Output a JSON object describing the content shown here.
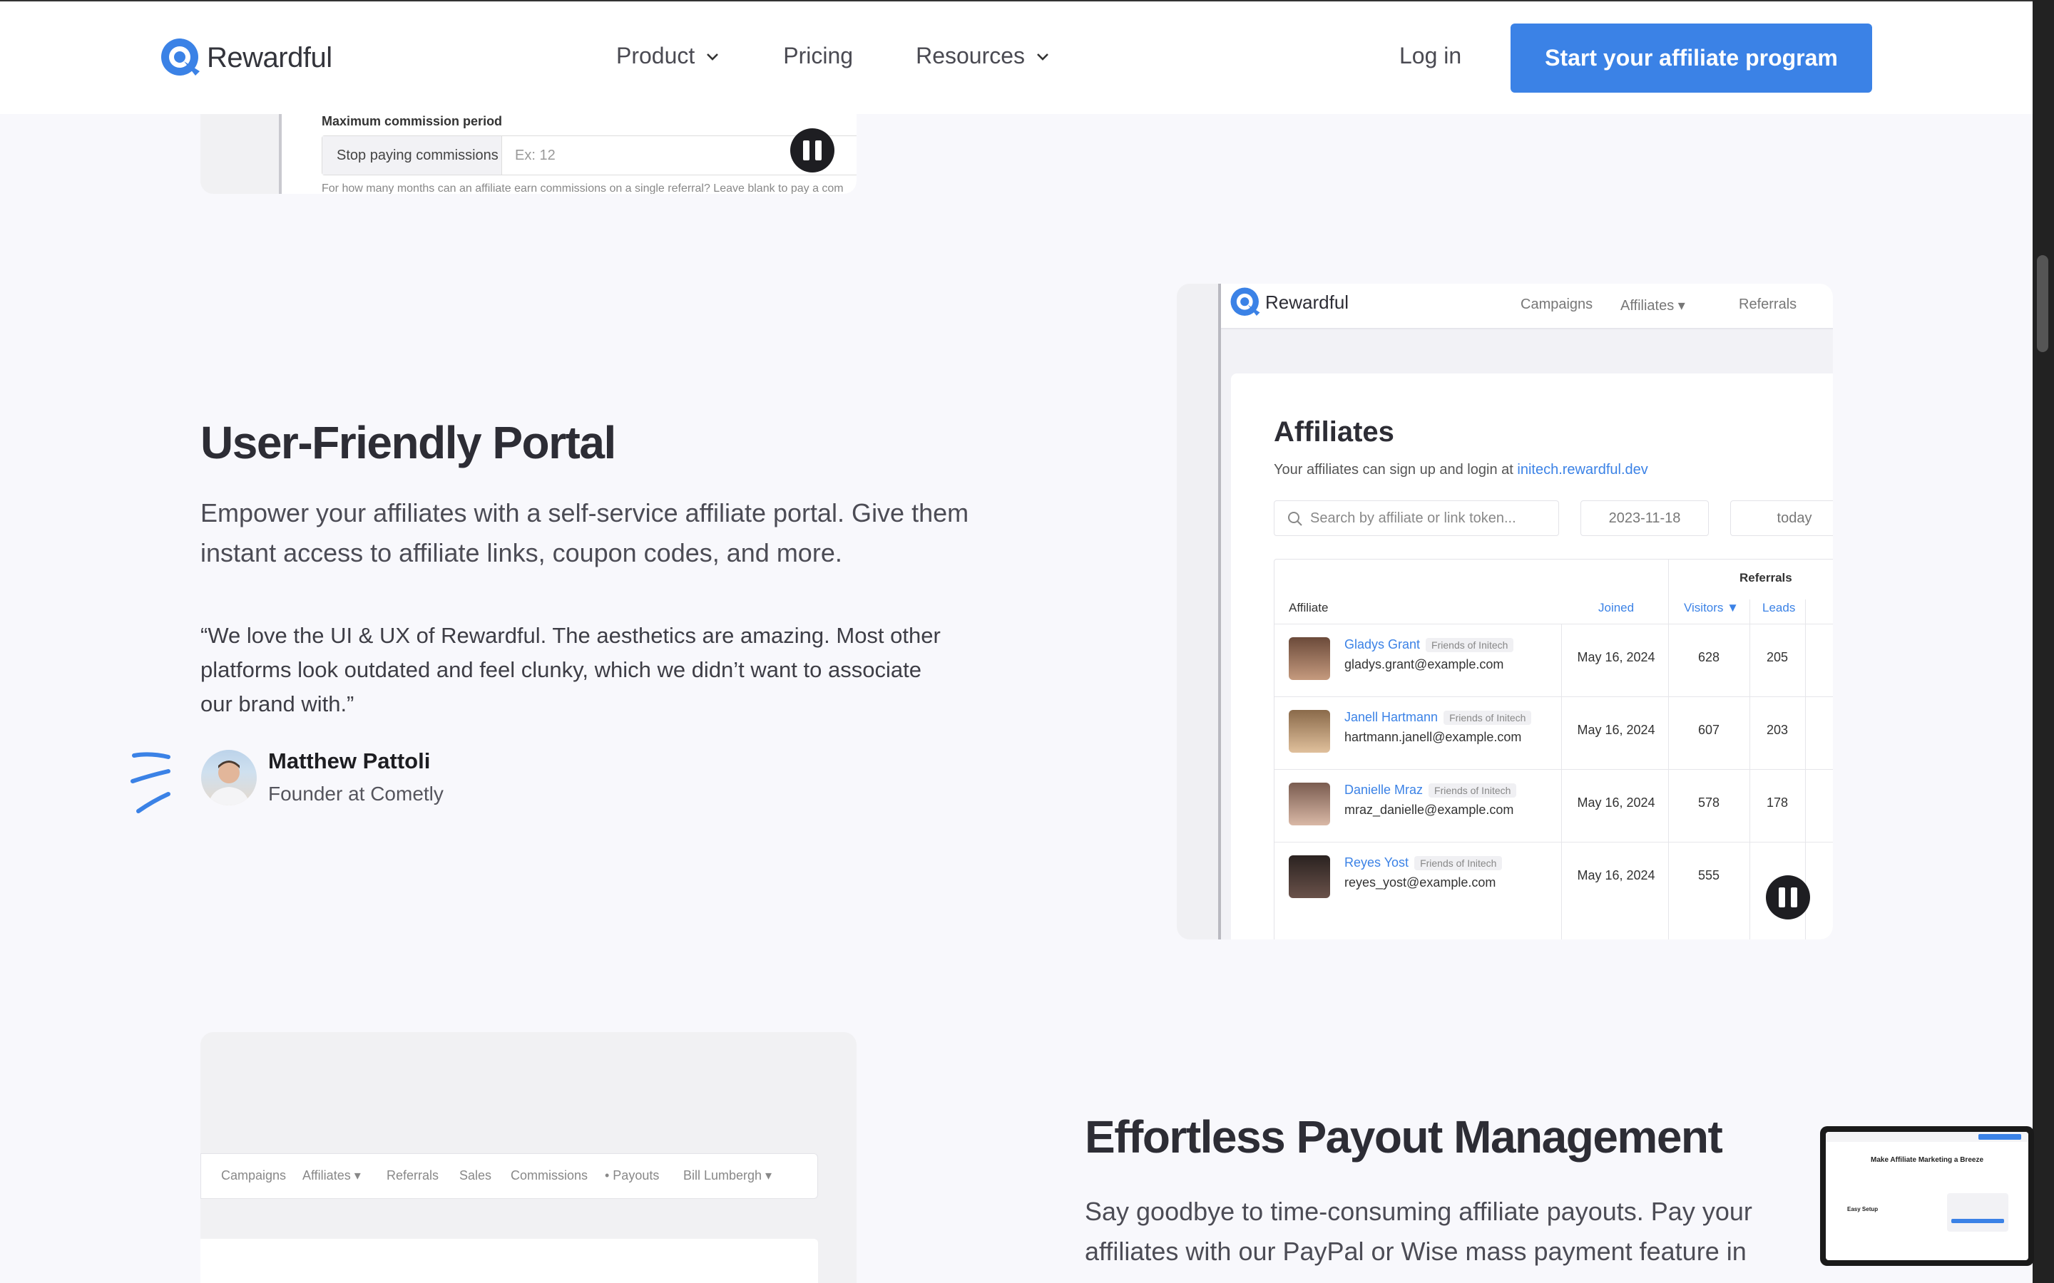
{
  "header": {
    "brand": "Rewardful",
    "nav": [
      {
        "label": "Product",
        "has_menu": true
      },
      {
        "label": "Pricing",
        "has_menu": false
      },
      {
        "label": "Resources",
        "has_menu": true
      }
    ],
    "login": "Log in",
    "cta": "Start your affiliate program"
  },
  "top_card": {
    "label": "Maximum commission period",
    "prefix": "Stop paying commissions",
    "placeholder": "Ex: 12",
    "help": "For how many months can an affiliate earn commissions on a single referral? Leave blank to pay a com"
  },
  "portal_section": {
    "title": "User-Friendly Portal",
    "lead": "Empower your affiliates with a self-service affiliate portal. Give them instant access to affiliate links, coupon codes, and more.",
    "quote": "“We love the UI & UX of Rewardful. The aesthetics are amazing. Most other platforms look outdated and feel clunky, which we didn’t want to associate our brand with.”",
    "author_name": "Matthew Pattoli",
    "author_role": "Founder at Cometly"
  },
  "portal_mock": {
    "brand": "Rewardful",
    "nav": [
      "Campaigns",
      "Affiliates ▾",
      "Referrals"
    ],
    "title": "Affiliates",
    "subtitle": "Your affiliates can sign up and login at",
    "subtitle_link": "initech.rewardful.dev",
    "search_placeholder": "Search by affiliate or link token...",
    "date_from": "2023-11-18",
    "date_to": "today",
    "group_header": "Referrals",
    "columns": [
      "Affiliate",
      "Joined",
      "Visitors ▼",
      "Leads"
    ],
    "tag": "Friends of Initech",
    "rows": [
      {
        "name": "Gladys Grant",
        "email": "gladys.grant@example.com",
        "joined": "May 16, 2024",
        "visitors": "628",
        "leads": "205"
      },
      {
        "name": "Janell Hartmann",
        "email": "hartmann.janell@example.com",
        "joined": "May 16, 2024",
        "visitors": "607",
        "leads": "203"
      },
      {
        "name": "Danielle Mraz",
        "email": "mraz_danielle@example.com",
        "joined": "May 16, 2024",
        "visitors": "578",
        "leads": "178"
      },
      {
        "name": "Reyes Yost",
        "email": "reyes_yost@example.com",
        "joined": "May 16, 2024",
        "visitors": "555",
        "leads": ""
      }
    ]
  },
  "payout_section": {
    "title": "Effortless Payout Management",
    "lead": "Say goodbye to time-consuming affiliate payouts. Pay your affiliates with our PayPal or Wise mass payment feature in"
  },
  "payout_mock": {
    "nav": [
      "Campaigns",
      "Affiliates ▾",
      "Referrals",
      "Sales",
      "Commissions",
      "• Payouts",
      "Bill Lumbergh ▾"
    ]
  },
  "preview": {
    "headline": "Make Affiliate Marketing a Breeze",
    "item": "Easy Setup"
  },
  "colors": {
    "accent": "#3b82e6",
    "text": "#2d2d35",
    "background": "#f8f8fc"
  }
}
